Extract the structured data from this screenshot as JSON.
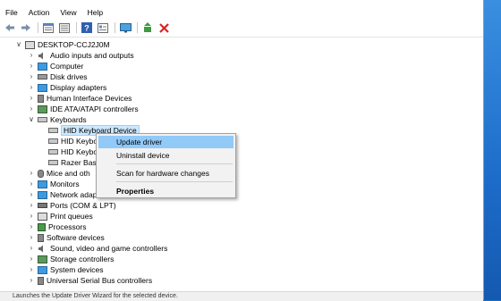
{
  "menubar": {
    "items": [
      "File",
      "Action",
      "View",
      "Help"
    ]
  },
  "toolbar": {
    "icons": [
      "back-arrow-icon",
      "forward-arrow-icon",
      "properties-icon",
      "print-icon",
      "help-icon",
      "details-icon",
      "monitor-icon",
      "update-driver-icon",
      "uninstall-x-icon"
    ]
  },
  "tree": {
    "root": "DESKTOP-CCJ2J0M",
    "categories": [
      "Audio inputs and outputs",
      "Computer",
      "Disk drives",
      "Display adapters",
      "Human Interface Devices",
      "IDE ATA/ATAPI controllers",
      "Keyboards",
      "Mice and oth",
      "Monitors",
      "Network adap",
      "Ports (COM & LPT)",
      "Print queues",
      "Processors",
      "Software devices",
      "Sound, video and game controllers",
      "Storage controllers",
      "System devices",
      "Universal Serial Bus controllers"
    ],
    "keyboards": [
      "HID Keyboard Device",
      "HID Keybo",
      "HID Keybo",
      "Razer Basi"
    ]
  },
  "context_menu": {
    "update_driver": "Update driver",
    "uninstall_device": "Uninstall device",
    "scan": "Scan for hardware changes",
    "properties": "Properties"
  },
  "status": {
    "text": "Launches the Update Driver Wizard for the selected device."
  },
  "colors": {
    "selection": "#cce8ff",
    "menu_highlight": "#91c9f7",
    "desktop": "#1e6fc4"
  }
}
